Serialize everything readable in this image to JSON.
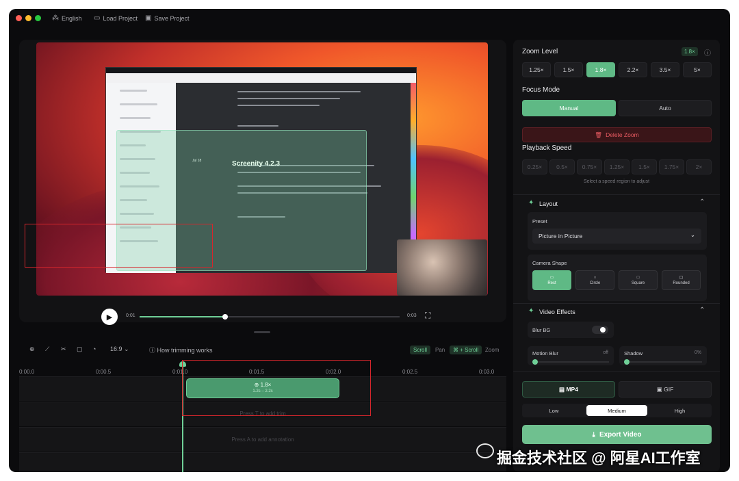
{
  "titlebar": {
    "language": "English",
    "load": "Load Project",
    "save": "Save Project"
  },
  "screen": {
    "title": "Screenity 4.2.3",
    "date": "Jul 18"
  },
  "player": {
    "current": "0:01",
    "end": "0:03",
    "progress": 0.33
  },
  "toolbar": {
    "aspect": "16:9",
    "how": "How trimming works",
    "scroll": "Scroll",
    "pan": "Pan",
    "cmd_scroll": "⌘ + Scroll",
    "zoom": "Zoom"
  },
  "ruler": [
    "0:00.0",
    "0:00.5",
    "0:01.0",
    "0:01.5",
    "0:02.0",
    "0:02.5",
    "0:03.0"
  ],
  "clip": {
    "label": "1.8×",
    "range": "1.2s – 2.2s"
  },
  "hints": {
    "trim": "Press T to add trim",
    "annotation": "Press A to add annotation"
  },
  "panel": {
    "zoom_title": "Zoom Level",
    "zoom_badge": "1.8×",
    "zoom_levels": [
      "1.25×",
      "1.5×",
      "1.8×",
      "2.2×",
      "3.5×",
      "5×"
    ],
    "focus_title": "Focus Mode",
    "focus_manual": "Manual",
    "focus_auto": "Auto",
    "delete_zoom": "Delete Zoom",
    "speed_title": "Playback Speed",
    "speeds": [
      "0.25×",
      "0.5×",
      "0.75×",
      "1.25×",
      "1.5×",
      "1.75×",
      "2×"
    ],
    "speed_hint": "Select a speed region to adjust",
    "layout_title": "Layout",
    "preset_label": "Preset",
    "preset_value": "Picture in Picture",
    "camera_shape": "Camera Shape",
    "shapes": [
      "Rect",
      "Circle",
      "Square",
      "Rounded"
    ],
    "effects_title": "Video Effects",
    "blur_bg": "Blur BG",
    "motion_blur": "Motion Blur",
    "motion_blur_value": "off",
    "shadow": "Shadow",
    "shadow_value": "0%",
    "mp4": "MP4",
    "gif": "GIF",
    "quality": [
      "Low",
      "Medium",
      "High"
    ],
    "export": "Export Video"
  },
  "watermark": "掘金技术社区 @ 阿星AI工作室",
  "colors": {
    "accent": "#5fb985",
    "background": "#0b0b0d",
    "danger": "#ee5d64"
  }
}
